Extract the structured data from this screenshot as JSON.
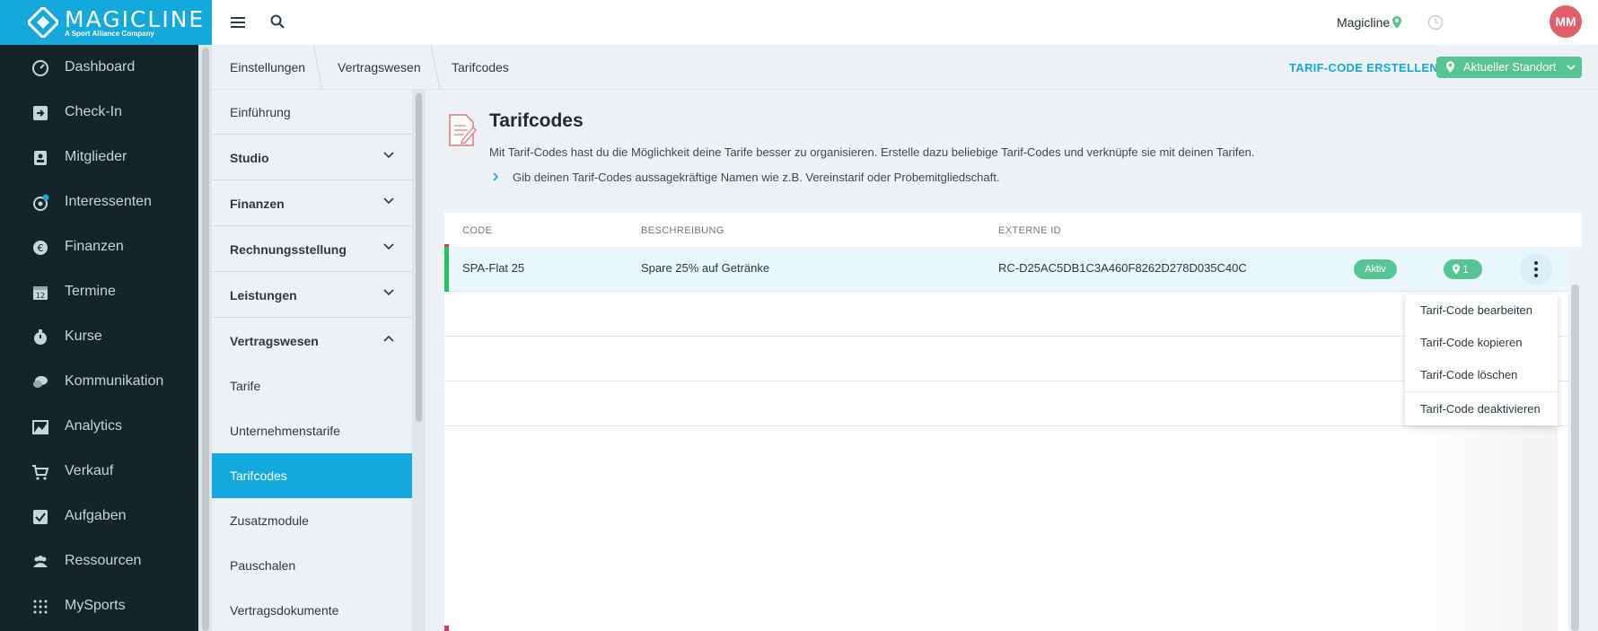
{
  "brand": {
    "name": "MAGICLINE",
    "tagline": "A Sport Alliance Company",
    "color": "#14a9dc"
  },
  "topbar": {
    "studio": "Magicline",
    "avatar_initials": "MM",
    "avatar_color": "#e45b6a"
  },
  "sidebar": {
    "items": [
      {
        "label": "Dashboard",
        "icon": "dashboard-icon"
      },
      {
        "label": "Check-In",
        "icon": "check-in-icon"
      },
      {
        "label": "Mitglieder",
        "icon": "members-icon"
      },
      {
        "label": "Interessenten",
        "icon": "prospects-icon"
      },
      {
        "label": "Finanzen",
        "icon": "euro-icon"
      },
      {
        "label": "Termine",
        "icon": "calendar-icon"
      },
      {
        "label": "Kurse",
        "icon": "stopwatch-icon"
      },
      {
        "label": "Kommunikation",
        "icon": "chat-icon"
      },
      {
        "label": "Analytics",
        "icon": "chart-icon"
      },
      {
        "label": "Verkauf",
        "icon": "cart-icon"
      },
      {
        "label": "Aufgaben",
        "icon": "checkbox-icon"
      },
      {
        "label": "Ressourcen",
        "icon": "people-icon"
      },
      {
        "label": "MySports",
        "icon": "mysports-icon"
      }
    ]
  },
  "breadcrumb": [
    "Einstellungen",
    "Vertragswesen",
    "Tarifcodes"
  ],
  "actions": {
    "create": "TARIF-CODE ERSTELLEN",
    "location": "Aktueller Standort"
  },
  "submenu": {
    "items": [
      {
        "label": "Einführung",
        "bold": false
      },
      {
        "label": "Studio",
        "bold": true,
        "chevron": "down"
      },
      {
        "label": "Finanzen",
        "bold": true,
        "chevron": "down"
      },
      {
        "label": "Rechnungsstellung",
        "bold": true,
        "chevron": "down"
      },
      {
        "label": "Leistungen",
        "bold": true,
        "chevron": "down"
      },
      {
        "label": "Vertragswesen",
        "bold": true,
        "chevron": "up"
      },
      {
        "label": "Tarife",
        "bold": false
      },
      {
        "label": "Unternehmenstarife",
        "bold": false
      },
      {
        "label": "Tarifcodes",
        "bold": false,
        "active": true
      },
      {
        "label": "Zusatzmodule",
        "bold": false
      },
      {
        "label": "Pauschalen",
        "bold": false
      },
      {
        "label": "Vertragsdokumente",
        "bold": false
      }
    ]
  },
  "page": {
    "title": "Tarifcodes",
    "description": "Mit Tarif-Codes hast du die Möglichkeit deine Tarife besser zu organisieren. Erstelle dazu beliebige Tarif-Codes und verknüpfe sie mit deinen Tarifen.",
    "hint": "Gib deinen Tarif-Codes aussagekräftige Namen wie z.B. Vereinstarif oder Probemitgliedschaft."
  },
  "table": {
    "columns": [
      "CODE",
      "BESCHREIBUNG",
      "EXTERNE ID"
    ],
    "rows": [
      {
        "code": "SPA-Flat 25",
        "description": "Spare 25% auf Getränke",
        "external_id": "RC-D25AC5DB1C3A460F8262D278D035C40C",
        "status": "Aktiv",
        "locations": "1"
      }
    ]
  },
  "menu": {
    "items": [
      "Tarif-Code bearbeiten",
      "Tarif-Code kopieren",
      "Tarif-Code löschen",
      "Tarif-Code deaktivieren"
    ]
  }
}
